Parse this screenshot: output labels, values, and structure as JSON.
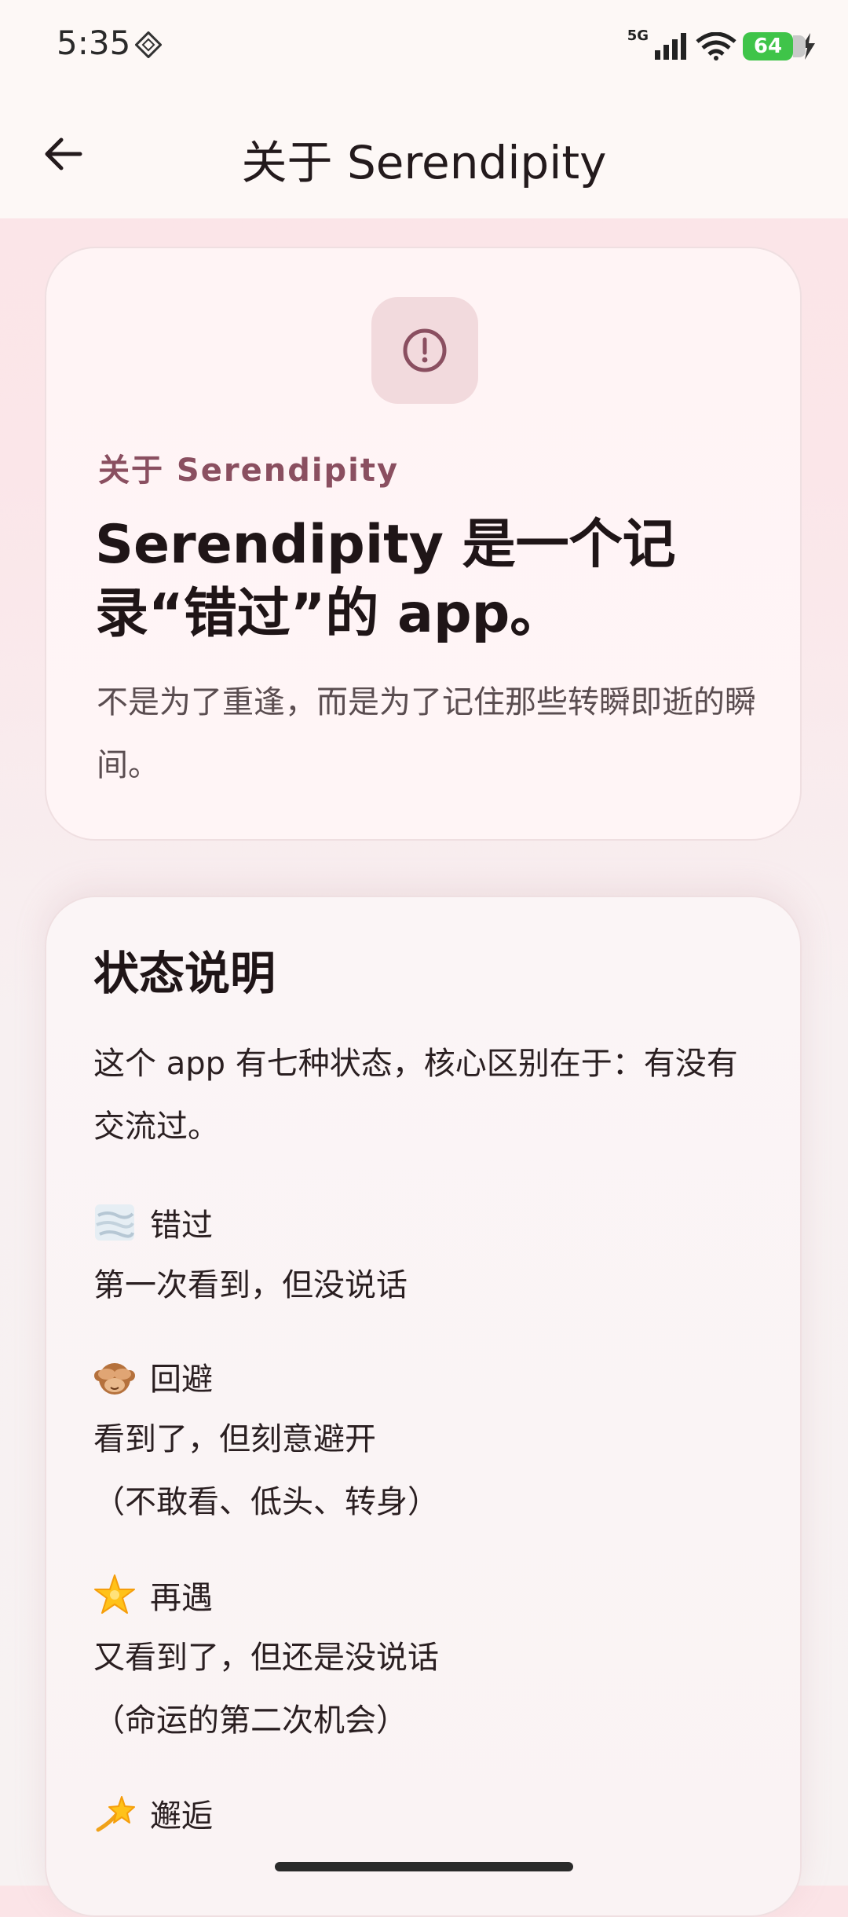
{
  "status_bar": {
    "time": "5:35",
    "network": "5G",
    "battery": "64"
  },
  "app_bar": {
    "title": "关于 Serendipity"
  },
  "intro_card": {
    "overline": "关于 Serendipity",
    "heading": "Serendipity 是一个记录“错过”的 app。",
    "body": "不是为了重逢，而是为了记住那些转瞬即逝的瞬间。"
  },
  "states_card": {
    "title": "状态说明",
    "intro": "这个 app 有七种状态，核心区别在于：有没有交流过。",
    "states": [
      {
        "icon": "fog-icon",
        "name": "错过",
        "desc": "第一次看到，但没说话"
      },
      {
        "icon": "see-no-evil-monkey-icon",
        "name": "回避",
        "desc": "看到了，但刻意避开\n（不敢看、低头、转身）"
      },
      {
        "icon": "glowing-star-icon",
        "name": "再遇",
        "desc": "又看到了，但还是没说话\n（命运的第二次机会）"
      },
      {
        "icon": "dizzy-icon",
        "name": "邂逅",
        "desc": ""
      }
    ]
  }
}
